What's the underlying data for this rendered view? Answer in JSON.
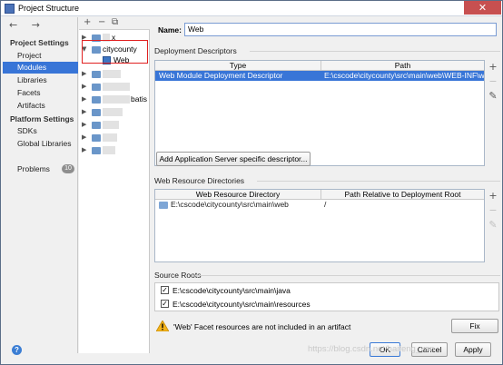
{
  "window": {
    "title": "Project Structure",
    "close_glyph": "✕"
  },
  "nav": {
    "arrows": "← →",
    "project_settings_label": "Project Settings",
    "project_settings": [
      "Project",
      "Modules",
      "Libraries",
      "Facets",
      "Artifacts"
    ],
    "selected": "Modules",
    "platform_settings_label": "Platform Settings",
    "platform_settings": [
      "SDKs",
      "Global Libraries"
    ],
    "problems": "Problems",
    "problems_count": "10"
  },
  "tree": {
    "toolbar": [
      "+",
      "−",
      "⧉"
    ],
    "items": [
      {
        "label": "x",
        "expanded": false
      },
      {
        "label": "citycounty",
        "expanded": true
      },
      {
        "label": "Web",
        "child": true
      },
      {
        "label": "",
        "expanded": false
      },
      {
        "label": "",
        "expanded": false
      },
      {
        "label": "batis",
        "expanded": false
      },
      {
        "label": "",
        "expanded": false
      },
      {
        "label": "",
        "expanded": false
      },
      {
        "label": "",
        "expanded": false
      },
      {
        "label": "",
        "expanded": false
      }
    ]
  },
  "facet": {
    "name_label": "Name:",
    "name_value": "Web",
    "deployment_descriptors_title": "Deployment Descriptors",
    "descriptor_columns": [
      "Type",
      "Path"
    ],
    "descriptor_rows": [
      {
        "type": "Web Module Deployment Descriptor",
        "path": "E:\\cscode\\citycounty\\src\\main\\web\\WEB-INF\\web.x"
      }
    ],
    "add_descriptor_button": "Add Application Server specific descriptor...",
    "web_resource_title": "Web Resource Directories",
    "web_resource_columns": [
      "Web Resource Directory",
      "Path Relative to Deployment Root"
    ],
    "web_resource_rows": [
      {
        "directory": "E:\\cscode\\citycounty\\src\\main\\web",
        "relative": "/"
      }
    ],
    "source_roots_title": "Source Roots",
    "source_roots": [
      {
        "path": "E:\\cscode\\citycounty\\src\\main\\java",
        "checked": true
      },
      {
        "path": "E:\\cscode\\citycounty\\src\\main\\resources",
        "checked": true
      }
    ],
    "warning_text": "'Web' Facet resources are not included in an artifact",
    "fix_button": "Fix"
  },
  "footer": {
    "help": "?",
    "ok": "OK",
    "cancel": "Cancel",
    "apply": "Apply",
    "watermark": "https://blog.csdn.net/haifeng_yan"
  },
  "colors": {
    "selection": "#3875d7",
    "highlight_box": "#e02020"
  }
}
